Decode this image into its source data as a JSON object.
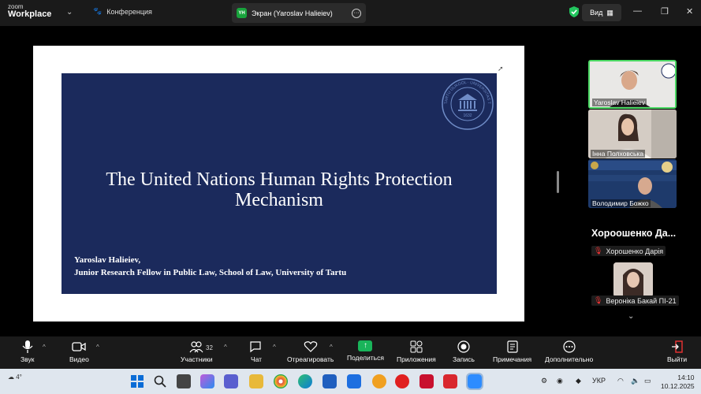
{
  "app": {
    "brand_small": "zoom",
    "brand_big": "Workplace"
  },
  "titlebar": {
    "conference_label": "Конференция",
    "share_tab_badge": "YH",
    "share_tab_label": "Экран (Yaroslav Halieiev)",
    "view_label": "Вид"
  },
  "slide": {
    "title_line1": "The United Nations Human Rights Protection",
    "title_line2": "Mechanism",
    "author_line1": "Yaroslav Halieiev,",
    "author_line2": "Junior Research Fellow in Public Law, School of Law, University of Tartu",
    "seal_text": "TARTU ÜLIKOOL · UNIVERSITAS TARTUENSIS",
    "seal_year": "1632"
  },
  "participants": {
    "tiles": [
      {
        "name": "Yaroslav Halieiev"
      },
      {
        "name": "Інна Полховська"
      },
      {
        "name": "Володимир Божко"
      }
    ],
    "featured_name": "Хороошенко  Да...",
    "muted": [
      {
        "name": "Хорошенко Дарія"
      },
      {
        "name": "Вероніка Бакай ПІ-21"
      }
    ]
  },
  "toolbar": {
    "audio": "Звук",
    "video": "Видео",
    "participants": "Участники",
    "participants_count": "32",
    "chat": "Чат",
    "react": "Отреагировать",
    "share": "Поделиться",
    "apps": "Приложения",
    "record": "Запись",
    "notes": "Примечания",
    "more": "Дополнительно",
    "leave": "Выйти"
  },
  "taskbar": {
    "weather_temp": "4°",
    "language": "УКР",
    "time": "14:10",
    "date": "10.12.2025"
  },
  "colors": {
    "slide_bg": "#1b2a5c",
    "active_speaker": "#4cd964",
    "share_green": "#19b45a"
  }
}
